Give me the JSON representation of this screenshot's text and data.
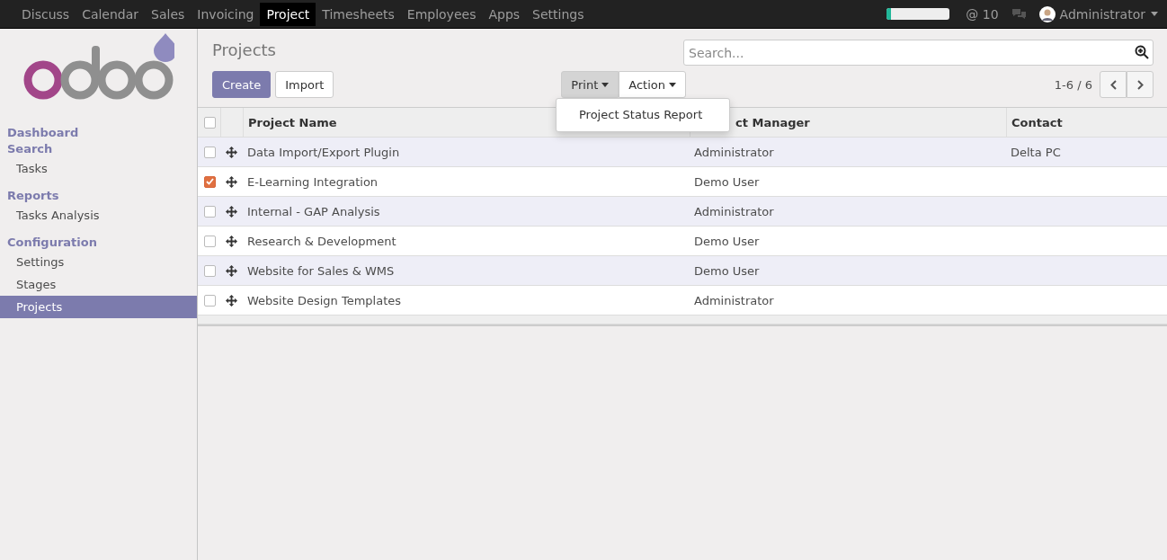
{
  "top_menu": [
    {
      "label": "Discuss",
      "selected": false
    },
    {
      "label": "Calendar",
      "selected": false
    },
    {
      "label": "Sales",
      "selected": false
    },
    {
      "label": "Invoicing",
      "selected": false
    },
    {
      "label": "Project",
      "selected": true
    },
    {
      "label": "Timesheets",
      "selected": false
    },
    {
      "label": "Employees",
      "selected": false
    },
    {
      "label": "Apps",
      "selected": false
    },
    {
      "label": "Settings",
      "selected": false
    }
  ],
  "systray": {
    "progress": {
      "level": 0.07
    },
    "mentions": "@ 10",
    "user": "Administrator"
  },
  "sidebar": {
    "items": [
      {
        "label": "Dashboard",
        "kind": "header",
        "selected": false
      },
      {
        "label": "Search",
        "kind": "header",
        "selected": false
      },
      {
        "label": "Tasks",
        "kind": "item",
        "selected": false
      },
      {
        "label": "Reports",
        "kind": "header",
        "selected": false
      },
      {
        "label": "Tasks Analysis",
        "kind": "item",
        "selected": false
      },
      {
        "label": "Configuration",
        "kind": "header",
        "selected": false
      },
      {
        "label": "Settings",
        "kind": "item",
        "selected": false
      },
      {
        "label": "Stages",
        "kind": "item",
        "selected": false
      },
      {
        "label": "Projects",
        "kind": "item",
        "selected": true
      }
    ]
  },
  "breadcrumb": "Projects",
  "search": {
    "placeholder": "Search..."
  },
  "buttons": {
    "create": "Create",
    "import": "Import",
    "print": "Print",
    "action": "Action"
  },
  "print_menu": [
    "Project Status Report"
  ],
  "pager": "1-6 / 6",
  "table": {
    "select_all": false,
    "columns": [
      "Project Name",
      "ct Manager",
      "Contact"
    ],
    "rows": [
      {
        "checked": false,
        "name": "Data Import/Export Plugin",
        "manager": "Administrator",
        "contact": "Delta PC"
      },
      {
        "checked": true,
        "name": "E-Learning Integration",
        "manager": "Demo User"
      },
      {
        "checked": false,
        "name": "Internal - GAP Analysis",
        "manager": "Administrator"
      },
      {
        "checked": false,
        "name": "Research & Development",
        "manager": "Demo User"
      },
      {
        "checked": false,
        "name": "Website for Sales & WMS",
        "manager": "Demo User"
      },
      {
        "checked": false,
        "name": "Website Design Templates",
        "manager": "Administrator"
      }
    ]
  }
}
